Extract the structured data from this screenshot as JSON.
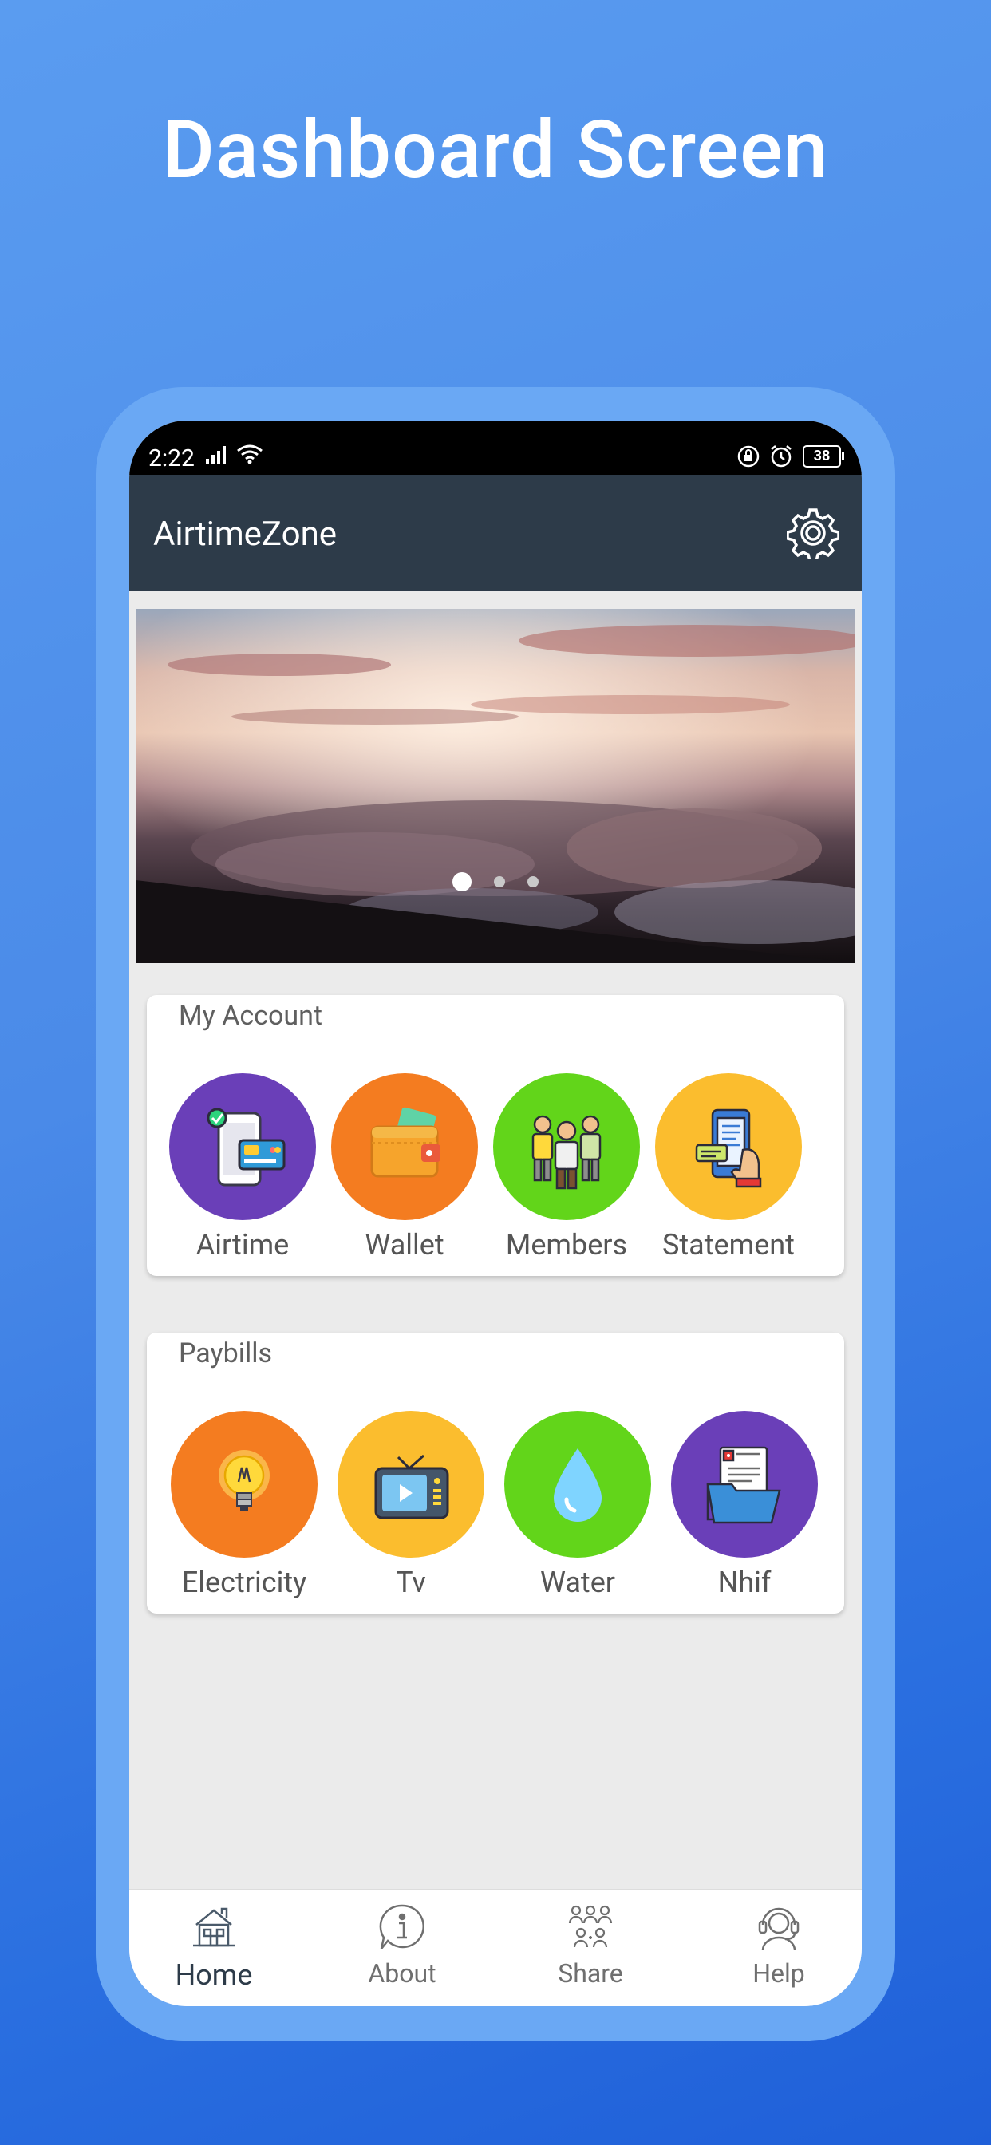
{
  "headline": "Dashboard Screen",
  "status": {
    "time": "2:22",
    "battery": "38"
  },
  "app": {
    "title": "AirtimeZone"
  },
  "banner": {
    "slides": 3,
    "active_slide": 1
  },
  "my_account": {
    "title": "My Account",
    "items": [
      {
        "label": "Airtime",
        "color": "#6a3fb8",
        "icon": "phone-card-icon"
      },
      {
        "label": "Wallet",
        "color": "#f47c20",
        "icon": "wallet-icon"
      },
      {
        "label": "Members",
        "color": "#62d51a",
        "icon": "members-icon"
      },
      {
        "label": "Statement",
        "color": "#fbbd2e",
        "icon": "statement-icon"
      }
    ]
  },
  "paybills": {
    "title": "Paybills",
    "items": [
      {
        "label": "Electricity",
        "color": "#f47c20",
        "icon": "lightbulb-icon"
      },
      {
        "label": "Tv",
        "color": "#fbbd2e",
        "icon": "tv-icon"
      },
      {
        "label": "Water",
        "color": "#62d51a",
        "icon": "water-drop-icon"
      },
      {
        "label": "Nhif",
        "color": "#6a3fb8",
        "icon": "medical-folder-icon"
      }
    ]
  },
  "nav": {
    "items": [
      {
        "label": "Home",
        "icon": "home-icon",
        "active": true
      },
      {
        "label": "About",
        "icon": "info-icon",
        "active": false
      },
      {
        "label": "Share",
        "icon": "share-people-icon",
        "active": false
      },
      {
        "label": "Help",
        "icon": "headset-icon",
        "active": false
      }
    ]
  }
}
